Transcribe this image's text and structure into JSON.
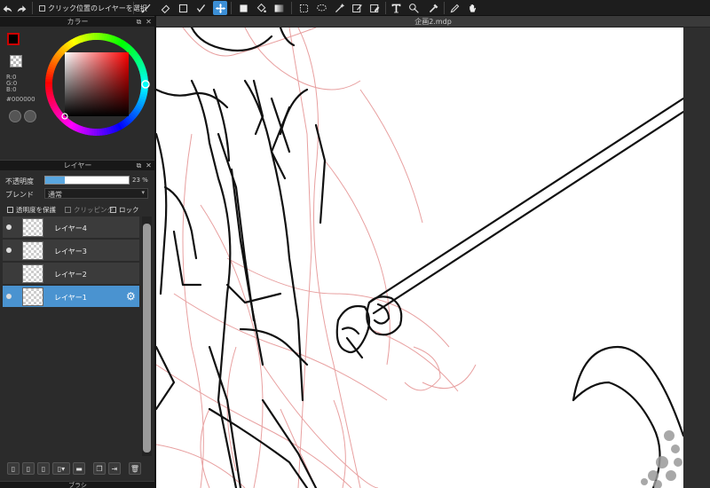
{
  "toolbar": {
    "auto_select_label": "クリック位置のレイヤーを選択"
  },
  "document": {
    "tab_title": "企画2.mdp"
  },
  "color_panel": {
    "title": "カラー",
    "foreground_color": "#000000",
    "rgb_r": "R:0",
    "rgb_g": "G:0",
    "rgb_b": "B:0",
    "hex": "#000000"
  },
  "layer_panel": {
    "title": "レイヤー",
    "opacity_label": "不透明度",
    "opacity_value": "23 %",
    "opacity_fraction": 0.23,
    "blend_label": "ブレンド",
    "blend_value": "通常",
    "protect_alpha_label": "透明度を保護",
    "clipping_label": "クリッピング",
    "lock_label": "ロック",
    "layers": [
      {
        "name": "レイヤー4",
        "visible": true,
        "selected": false
      },
      {
        "name": "レイヤー3",
        "visible": true,
        "selected": false
      },
      {
        "name": "レイヤー2",
        "visible": false,
        "selected": false
      },
      {
        "name": "レイヤー1",
        "visible": true,
        "selected": true
      }
    ]
  },
  "bottom_panel": {
    "title": "ブラシ"
  },
  "colors": {
    "accent": "#3c8fd6",
    "selected_layer": "#4a93d0",
    "sketch_red": "#e8a0a0"
  }
}
